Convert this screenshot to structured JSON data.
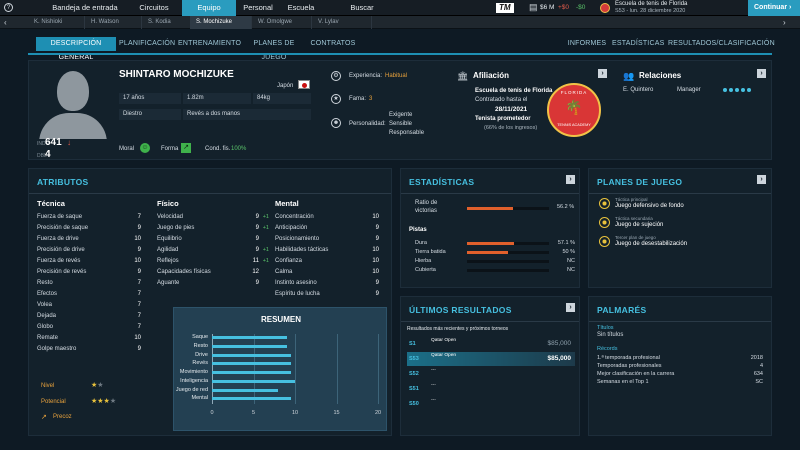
{
  "topnav": {
    "items": [
      "Bandeja de entrada",
      "Circuitos",
      "Equipo",
      "Personal",
      "Escuela",
      "Buscar"
    ],
    "active": "Equipo",
    "logo": "TM",
    "money": "$6 M",
    "plus1": "+$0",
    "minus1": "-$0",
    "school_name": "Escuela de tenis de Florida",
    "date": "S53 - lun. 28 diciembre 2020",
    "continue": "Continuar"
  },
  "players": [
    "K. Nishioki",
    "H. Watson",
    "S. Kodia",
    "S. Mochizuke",
    "W. Omolgwe",
    "V. Lylav"
  ],
  "selected_player": "S. Mochizuke",
  "subnav": {
    "left": [
      "DESCRIPCIÓN GENERAL",
      "PLANIFICACIÓN",
      "ENTRENAMIENTO",
      "PLANES DE JUEGO",
      "CONTRATOS"
    ],
    "right": [
      "INFORMES",
      "ESTADÍSTICAS",
      "RESULTADOS/CLASIFICACIÓN"
    ],
    "active": "DESCRIPCIÓN GENERAL"
  },
  "profile": {
    "name": "SHINTARO MOCHIZUKE",
    "country": "Japón",
    "age": "17 años",
    "height": "1.82m",
    "weight": "84kg",
    "hand": "Diestro",
    "backhand": "Revés a dos manos",
    "rank_label": "INDV",
    "rank": "641",
    "rank_arrow": "↓",
    "rank2_label": "DBL",
    "rank2": "4",
    "moral_label": "Moral",
    "form_label": "Forma",
    "cond_label": "Cond. fis.",
    "cond_value": "100%",
    "exp_label": "Experiencia:",
    "exp_value": "Habitual",
    "fame_label": "Fama:",
    "fame_value": "3",
    "pers_label": "Personalidad:",
    "pers_values": [
      "Exigente",
      "Sensible",
      "Responsable"
    ]
  },
  "affiliation": {
    "title": "Afiliación",
    "school": "Escuela de tenis de Florida",
    "contract": "Contratado hasta el",
    "date": "28/11/2021",
    "promising": "Tenista prometedor",
    "income": "(66% de los ingresos)",
    "logo_text": "FLORIDA",
    "logo_sub": "TENNIS ACADEMY"
  },
  "relations": {
    "title": "Relaciones",
    "name": "E. Quintero",
    "role": "Manager"
  },
  "attributes": {
    "title": "ATRIBUTOS",
    "tecnica": {
      "title": "Técnica",
      "items": [
        [
          "Fuerza de saque",
          "7"
        ],
        [
          "Precisión de saque",
          "9"
        ],
        [
          "Fuerza de drive",
          "10"
        ],
        [
          "Precisión de drive",
          "9"
        ],
        [
          "Fuerza de revés",
          "10"
        ],
        [
          "Precisión de revés",
          "9"
        ],
        [
          "Resto",
          "7"
        ],
        [
          "Efectos",
          "7"
        ],
        [
          "Volea",
          "7"
        ],
        [
          "Dejada",
          "7"
        ],
        [
          "Globo",
          "7"
        ],
        [
          "Remate",
          "10"
        ],
        [
          "Golpe maestro",
          "9"
        ]
      ]
    },
    "fisico": {
      "title": "Físico",
      "items": [
        [
          "Velocidad",
          "9",
          "+1"
        ],
        [
          "Juego de pies",
          "9",
          "+1"
        ],
        [
          "Equilibrio",
          "9",
          ""
        ],
        [
          "Agilidad",
          "9",
          "+1"
        ],
        [
          "Reflejos",
          "11",
          "+1"
        ],
        [
          "Capacidades físicas",
          "12",
          ""
        ],
        [
          "Aguante",
          "9",
          ""
        ]
      ]
    },
    "mental": {
      "title": "Mental",
      "items": [
        [
          "Concentración",
          "10"
        ],
        [
          "Anticipación",
          "9"
        ],
        [
          "Posicionamiento",
          "9"
        ],
        [
          "Habilidades tácticas",
          "10"
        ],
        [
          "Confianza",
          "10"
        ],
        [
          "Calma",
          "10"
        ],
        [
          "Instinto asesino",
          "9"
        ],
        [
          "Espíritu de lucha",
          "9"
        ]
      ]
    },
    "nivel_label": "Nivel",
    "potencial_label": "Potencial",
    "precoz_label": "Precoz"
  },
  "resumen": {
    "title": "RESUMEN",
    "labels": [
      "Saque",
      "Resto",
      "Drive",
      "Revés",
      "Movimiento",
      "Inteligencia",
      "Juego de red",
      "Mental"
    ],
    "values": [
      9,
      9,
      9.5,
      9.5,
      9.5,
      10,
      8,
      9.5
    ],
    "ticks": [
      "0",
      "5",
      "10",
      "15",
      "20"
    ],
    "max": 20
  },
  "stats": {
    "title": "ESTADÍSTICAS",
    "ratio_label": "Ratio de victorias",
    "ratio_value": "56.2 %",
    "ratio": 0.562,
    "pistas_label": "Pistas",
    "surfaces": [
      [
        "Dura",
        "57.1 %",
        0.571
      ],
      [
        "Tierra batida",
        "50 %",
        0.5
      ],
      [
        "Hierba",
        "NC",
        0
      ],
      [
        "Cubierta",
        "NC",
        0
      ]
    ]
  },
  "plans": {
    "title": "PLANES DE JUEGO",
    "items": [
      [
        "Táctica principal",
        "Juego defensivo de fondo"
      ],
      [
        "Táctica secundaria",
        "Juego de sujeción"
      ],
      [
        "Tercer plan de juego",
        "Juego de desestabilización"
      ]
    ]
  },
  "results": {
    "title": "ÚLTIMOS RESULTADOS",
    "subtitle": "Resultados más recientes y próximos torneos",
    "rows": [
      [
        "S1",
        "Qatar Open",
        "$85,000"
      ],
      [
        "S53",
        "Qatar Open",
        "$85,000"
      ],
      [
        "S52",
        "---",
        ""
      ],
      [
        "S51",
        "---",
        ""
      ],
      [
        "S50",
        "---",
        ""
      ]
    ]
  },
  "palmares": {
    "title": "PALMARÉS",
    "titulos_label": "Títulos",
    "titulos_value": "Sin títulos",
    "records_label": "Récords",
    "records": [
      [
        "1.ª temporada profesional",
        "2018"
      ],
      [
        "Temporadas profesionales",
        "4"
      ],
      [
        "Mejor clasificación en la carrera",
        "634"
      ],
      [
        "Semanas en el Top 1",
        "SC"
      ]
    ]
  }
}
